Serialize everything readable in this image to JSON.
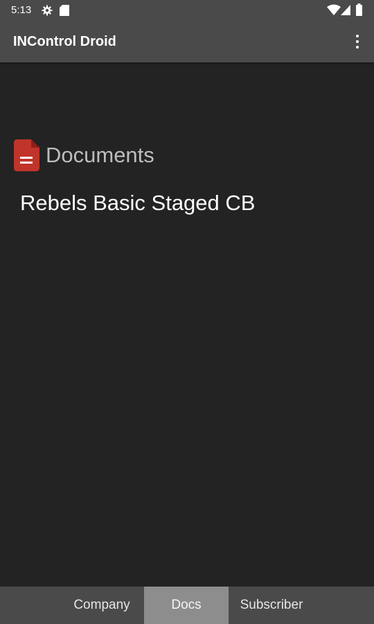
{
  "status_bar": {
    "time": "5:13",
    "icons": [
      "gear-icon",
      "sd-card-icon",
      "wifi-icon",
      "signal-icon",
      "battery-icon"
    ]
  },
  "app_bar": {
    "title": "INControl Droid",
    "menu_icon": "more-vert-icon"
  },
  "documents": {
    "header_icon": "document-icon",
    "header_icon_color": "#c0342b",
    "title": "Documents",
    "items": [
      {
        "label": "Rebels Basic Staged CB"
      }
    ]
  },
  "tabs": [
    {
      "label": "Company",
      "selected": false
    },
    {
      "label": "Docs",
      "selected": true
    },
    {
      "label": "Subscriber",
      "selected": false
    }
  ],
  "colors": {
    "background": "#232323",
    "bar": "#4a4a4a",
    "selected_tab": "#8d8d8d"
  }
}
